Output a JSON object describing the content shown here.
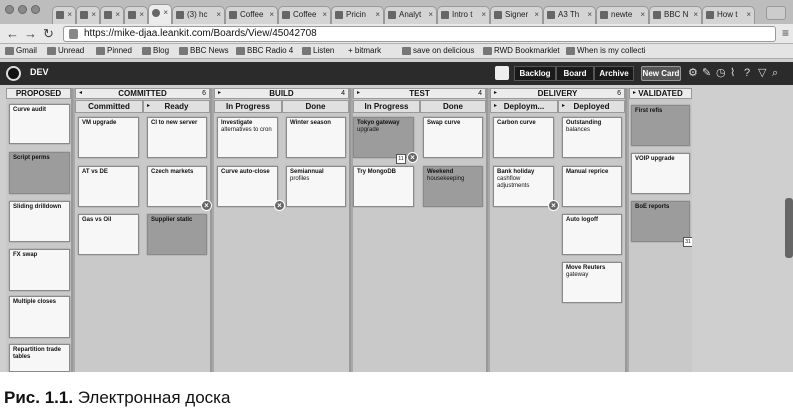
{
  "tabs": [
    {
      "label": "",
      "icon": "gmail-icon"
    },
    {
      "label": "",
      "icon": "bookmark-icon"
    },
    {
      "label": "",
      "icon": "page-icon"
    },
    {
      "label": "",
      "icon": "page-icon"
    },
    {
      "label": "",
      "icon": "page-icon",
      "active": true
    },
    {
      "label": "(3) hc",
      "icon": "page-icon"
    },
    {
      "label": "Coffee",
      "icon": "page-icon"
    },
    {
      "label": "Coffee",
      "icon": "page-icon"
    },
    {
      "label": "Pricin",
      "icon": "page-icon"
    },
    {
      "label": "Analyt",
      "icon": "page-icon"
    },
    {
      "label": "Intro t",
      "icon": "page-icon"
    },
    {
      "label": "Signer",
      "icon": "page-icon"
    },
    {
      "label": "A3 Th",
      "icon": "page-icon"
    },
    {
      "label": "newte",
      "icon": "page-icon"
    },
    {
      "label": "BBC N",
      "icon": "page-icon"
    },
    {
      "label": "How t",
      "icon": "page-icon"
    }
  ],
  "address": {
    "url": "https://mike-djaa.leankit.com/Boards/View/45042708"
  },
  "bookmarks": [
    {
      "label": "Gmail"
    },
    {
      "label": "Unread"
    },
    {
      "label": "Pinned"
    },
    {
      "label": "Blog"
    },
    {
      "label": "BBC News"
    },
    {
      "label": "BBC Radio 4"
    },
    {
      "label": "Listen"
    },
    {
      "label": "+ bitmark"
    },
    {
      "label": "save on delicious"
    },
    {
      "label": "RWD Bookmarklet"
    },
    {
      "label": "When is my collecti"
    }
  ],
  "header": {
    "board_name": "DEV",
    "views": [
      "Backlog",
      "Board",
      "Archive"
    ],
    "new_card": "New Card"
  },
  "lanes": {
    "proposed": {
      "title": "PROPOSED"
    },
    "committed": {
      "title": "COMMITTED",
      "count": "6",
      "sub": [
        "Committed",
        "Ready"
      ]
    },
    "build": {
      "title": "BUILD",
      "count": "4",
      "sub": [
        "In Progress",
        "Done"
      ]
    },
    "test": {
      "title": "TEST",
      "count": "4",
      "sub": [
        "In Progress",
        "Done"
      ]
    },
    "delivery": {
      "title": "DELIVERY",
      "count": "6",
      "sub": [
        "Deploym...",
        "Deployed"
      ]
    },
    "validated": {
      "title": "VALIDATED"
    }
  },
  "cards": {
    "proposed": [
      {
        "title": "Curve audit",
        "desc": ""
      },
      {
        "title": "Script perms",
        "desc": ""
      },
      {
        "title": "Sliding drilldown",
        "desc": ""
      },
      {
        "title": "FX swap",
        "desc": ""
      },
      {
        "title": "Multiple closes",
        "desc": ""
      },
      {
        "title": "Repartition trade tables",
        "desc": ""
      }
    ],
    "committed": [
      {
        "title": "VM upgrade",
        "desc": ""
      },
      {
        "title": "AT vs DE",
        "desc": ""
      },
      {
        "title": "Gas vs Oil",
        "desc": ""
      }
    ],
    "ready": [
      {
        "title": "CI to new server",
        "desc": ""
      },
      {
        "title": "Czech markets",
        "desc": ""
      },
      {
        "title": "Supplier static",
        "desc": ""
      }
    ],
    "build_progress": [
      {
        "title": "Investigate",
        "desc": "alternatives to cron"
      },
      {
        "title": "Curve auto-close",
        "desc": ""
      }
    ],
    "build_done": [
      {
        "title": "Winter season",
        "desc": ""
      },
      {
        "title": "Semiannual",
        "desc": "profiles"
      }
    ],
    "test_progress": [
      {
        "title": "Tokyo gateway",
        "desc": "upgrade"
      },
      {
        "title": "Try MongoDB",
        "desc": ""
      }
    ],
    "test_done": [
      {
        "title": "Swap curve",
        "desc": ""
      },
      {
        "title": "Weekend",
        "desc": "housekeeping"
      }
    ],
    "deploying": [
      {
        "title": "Carbon curve",
        "desc": ""
      },
      {
        "title": "Bank holiday",
        "desc": "cashflow adjustments"
      }
    ],
    "deployed": [
      {
        "title": "Outstanding",
        "desc": "balances"
      },
      {
        "title": "Manual reprice",
        "desc": ""
      },
      {
        "title": "Auto logoff",
        "desc": ""
      },
      {
        "title": "Move Reuters",
        "desc": "gateway"
      }
    ],
    "validated": [
      {
        "title": "First refis",
        "desc": ""
      },
      {
        "title": "VOIP upgrade",
        "desc": ""
      },
      {
        "title": "BoE reports",
        "desc": ""
      }
    ]
  },
  "badges": {
    "tokyo_calendar": "11",
    "boe_calendar": "31"
  },
  "caption": {
    "prefix": "Рис. 1.1.",
    "text": "Электронная доска"
  },
  "colors": {
    "header_bg": "#2b2b2b",
    "board_bg": "#a8a8a8",
    "card_bg": "#f7f7f7",
    "card_dark": "#9c9c9c"
  }
}
